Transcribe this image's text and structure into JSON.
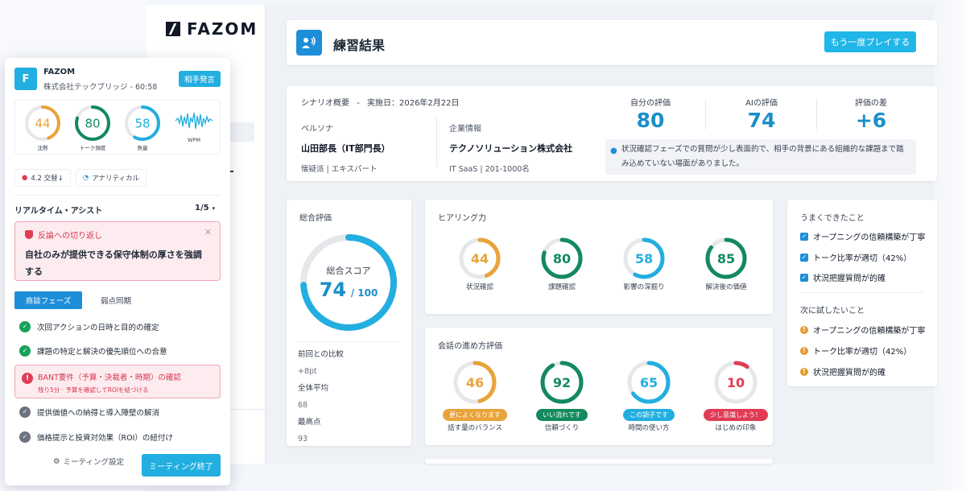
{
  "brand": {
    "logo_text": "FAZOM"
  },
  "header": {
    "title": "練習結果",
    "replay_label": "もう一度プレイする"
  },
  "scenario": {
    "overview": "シナリオ概要",
    "separator": "-",
    "date": "実施日：2026年2月22日",
    "persona_label": "ペルソナ",
    "persona_name": "山田部長（IT部門長）",
    "persona_sub": "懐疑派 | エキスパート",
    "company_label": "企業情報",
    "company_name": "テクノソリューション株式会社",
    "company_sub": "IT  SaaS | 201-1000名",
    "self_label": "自分の評価",
    "self_value": "80",
    "ai_label": "AIの評価",
    "ai_value": "74",
    "diff_label": "評価の差",
    "diff_value": "+6",
    "note": "状況確認フェーズでの質問が少し表面的で、相手の背景にある組織的な課題まで踏み込めていない場面がありました。"
  },
  "overall": {
    "title": "総合評価",
    "ring_label": "総合スコア",
    "score": 74,
    "score_text": "74",
    "max_text": "/ 100",
    "prev_label": "前回との比較",
    "prev_value": "+8pt",
    "avg_label": "全体平均",
    "avg_value": "68",
    "top_label": "最高点",
    "top_value": "93"
  },
  "hearing": {
    "title": "ヒアリング力",
    "items": [
      {
        "value": 44,
        "text": "44",
        "label": "状況確認",
        "color": "#e8a33a"
      },
      {
        "value": 80,
        "text": "80",
        "label": "課題確認",
        "color": "#138a5e"
      },
      {
        "value": 58,
        "text": "58",
        "label": "影響の深掘り",
        "color": "#22aee0"
      },
      {
        "value": 85,
        "text": "85",
        "label": "解決後の価値",
        "color": "#138a5e"
      }
    ]
  },
  "conversation": {
    "title": "会話の進め方評価",
    "items": [
      {
        "value": 46,
        "text": "46",
        "pill": "更によくなります",
        "label": "話す量のバランス",
        "color": "#e8a33a"
      },
      {
        "value": 92,
        "text": "92",
        "pill": "いい流れです",
        "label": "信頼づくり",
        "color": "#138a5e"
      },
      {
        "value": 65,
        "text": "65",
        "pill": "この調子です",
        "label": "時間の使い方",
        "color": "#22aee0"
      },
      {
        "value": 10,
        "text": "10",
        "pill": "少し意識しよう！",
        "label": "はじめの印象",
        "color": "#e13b55"
      }
    ]
  },
  "feedback": {
    "good_title": "うまくできたこと",
    "good": [
      "オープニングの信頼構築が丁寧",
      "トーク比率が適切（42%）",
      "状況把握質問が的確"
    ],
    "next_title": "次に試したいこと",
    "next": [
      "オープニングの信頼構築が丁寧",
      "トーク比率が適切（42%）",
      "状況把握質問が的確"
    ]
  },
  "panel": {
    "logo": "F",
    "name": "FAZOM",
    "company": "株式会社テックブリッジ - 60:58",
    "speak_button": "相手発言",
    "metrics": [
      {
        "value": 44,
        "text": "44",
        "label": "沈黙",
        "color": "#e8a33a"
      },
      {
        "value": 80,
        "text": "80",
        "label": "トーク頻度",
        "color": "#138a5e"
      },
      {
        "value": 58,
        "text": "58",
        "label": "熱量",
        "color": "#22aee0"
      }
    ],
    "wpm_label": "WPM",
    "tag1": "4.2  交替↓",
    "tag2": "アナリティカル",
    "assist_title": "リアルタイム・アシスト",
    "assist_count": "1/5",
    "alert_title": "反論への切り返し",
    "alert_body": "自社のみが提供できる保守体制の厚さを強調する",
    "tab_active": "商談フェーズ",
    "tab_other": "弱点同期",
    "steps_done": [
      "次回アクションの日時と目的の確定",
      "課題の特定と解決の優先順位への合意"
    ],
    "bant_title": "BANT要件（予算・決裁者・時期）の確認",
    "bant_sub": "残り5分 · 予算を確認してROIを紐づける",
    "steps_todo": [
      "提供価値への納得と導入障壁の解消",
      "価格提示と投資対効果（ROI）の紐付け"
    ],
    "settings_label": "ミーティング設定",
    "end_label": "ミーティング終了"
  }
}
